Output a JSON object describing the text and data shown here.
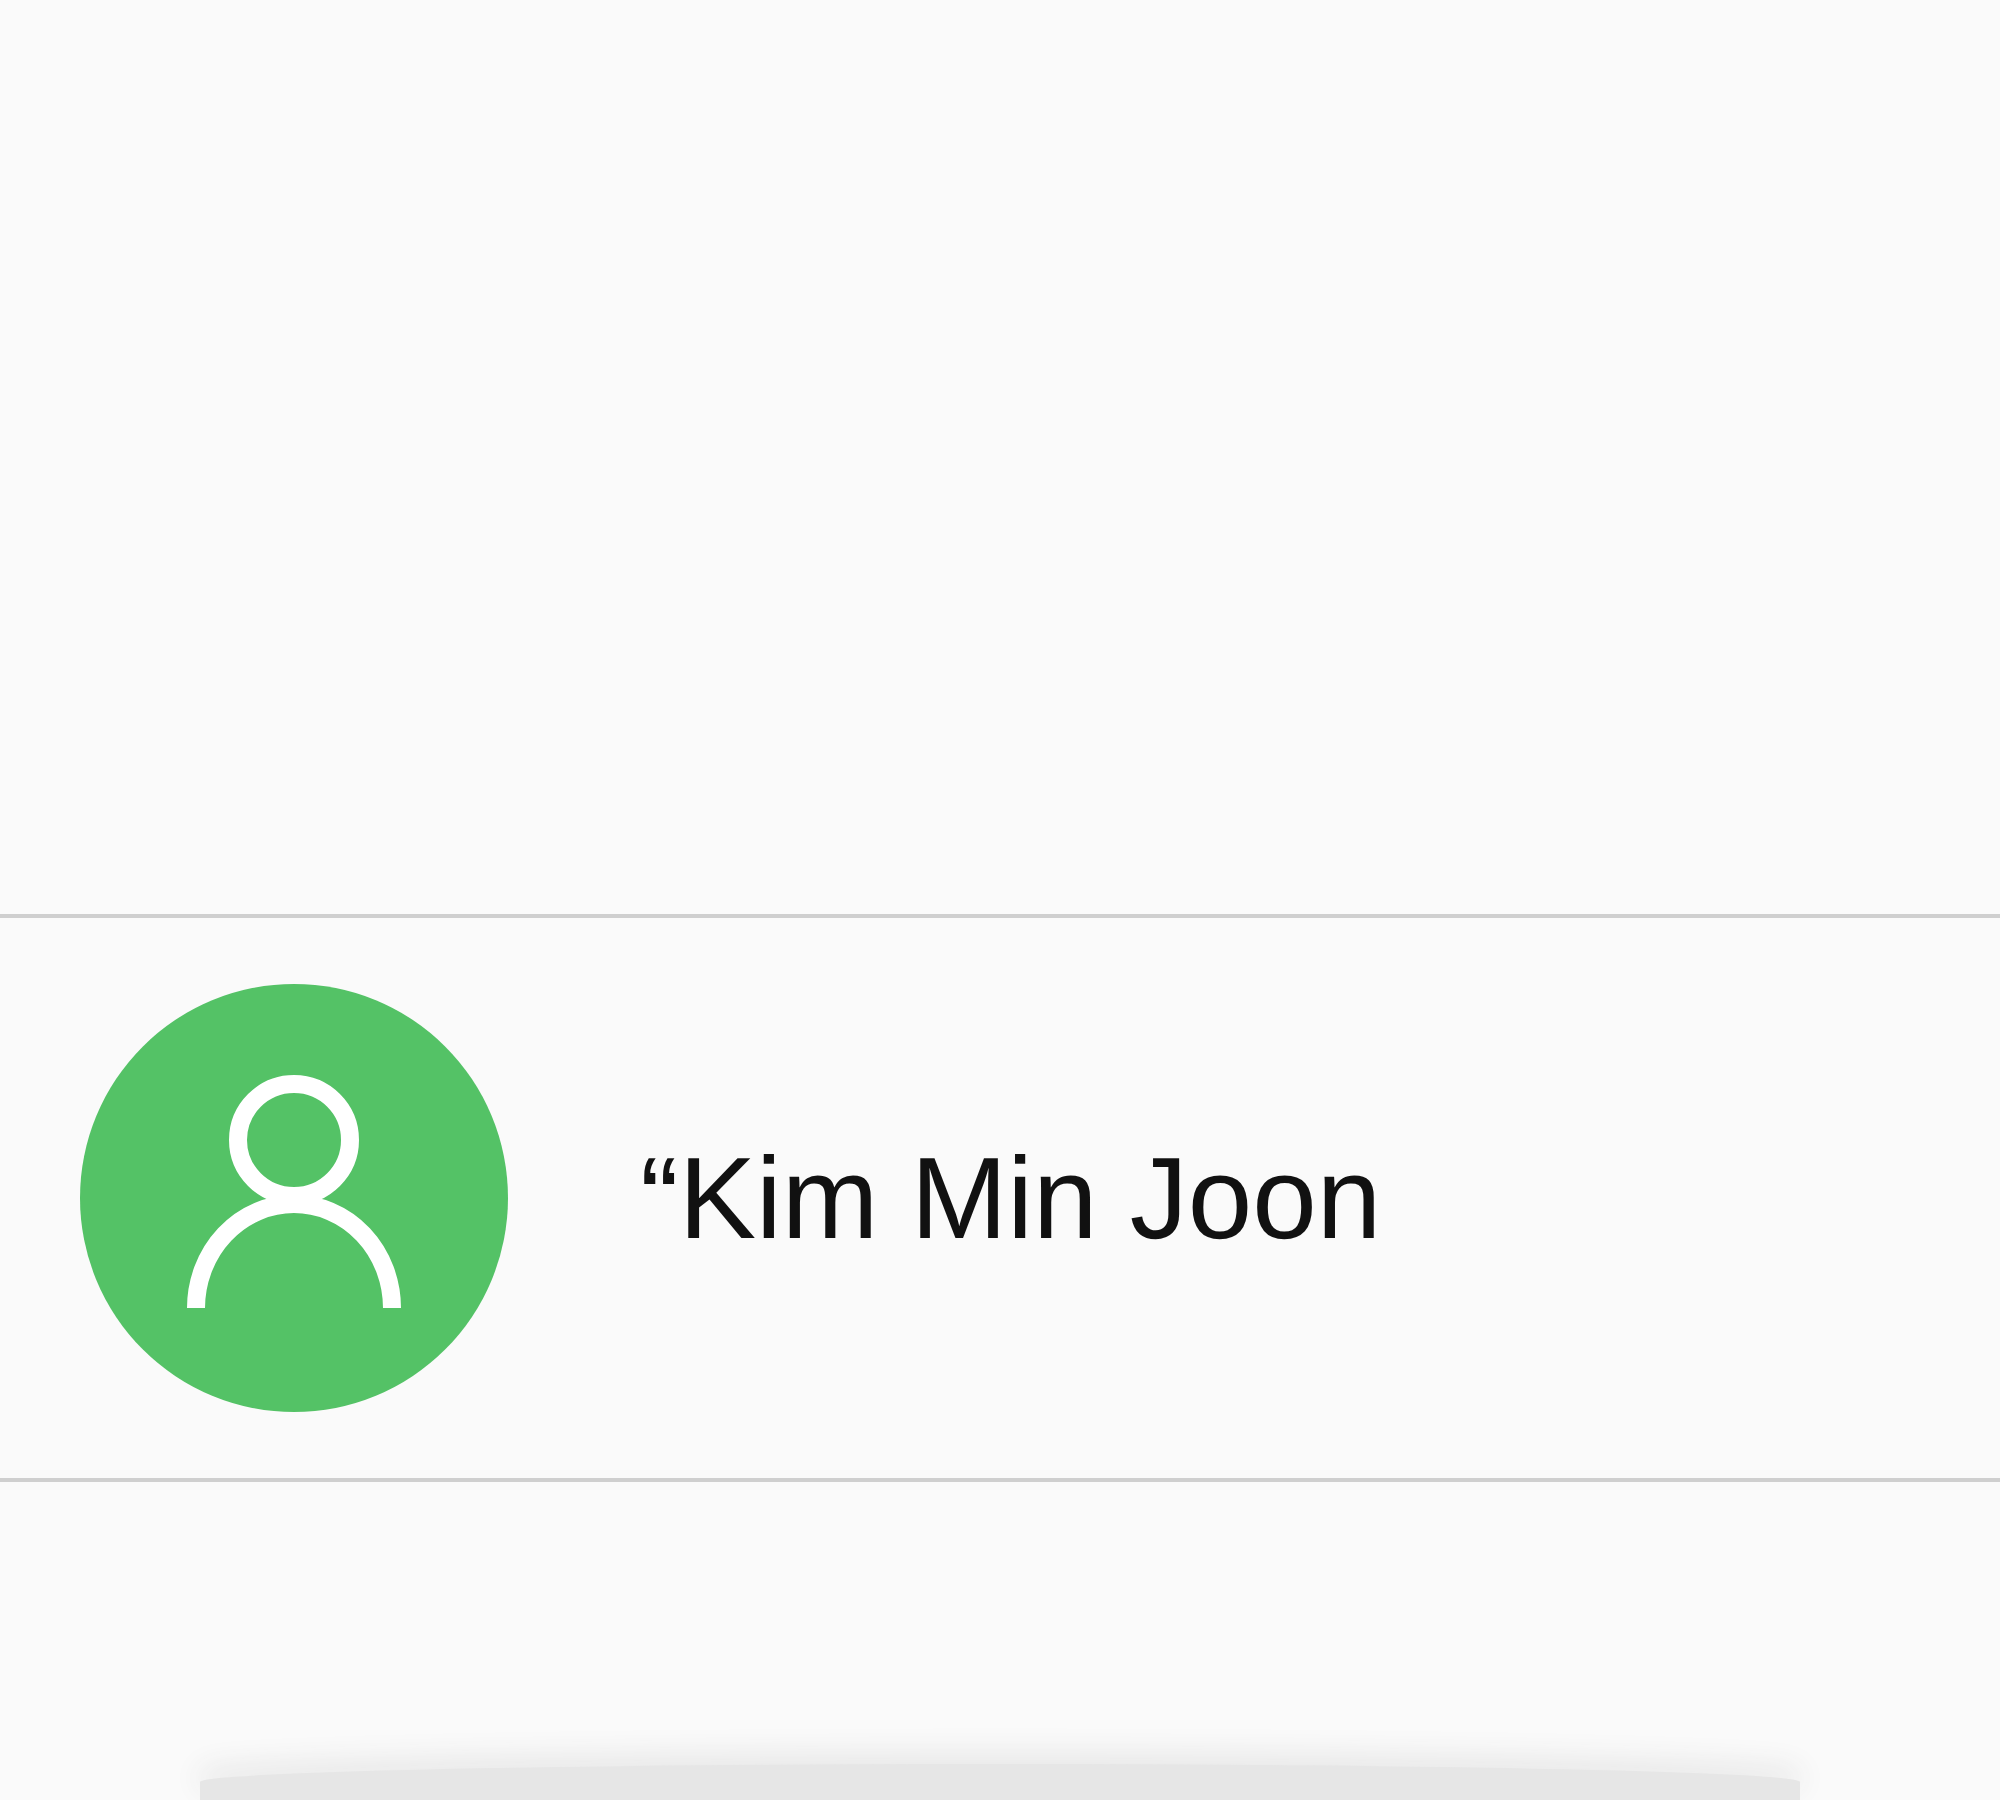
{
  "contact": {
    "name": "“Kim Min Joon"
  }
}
